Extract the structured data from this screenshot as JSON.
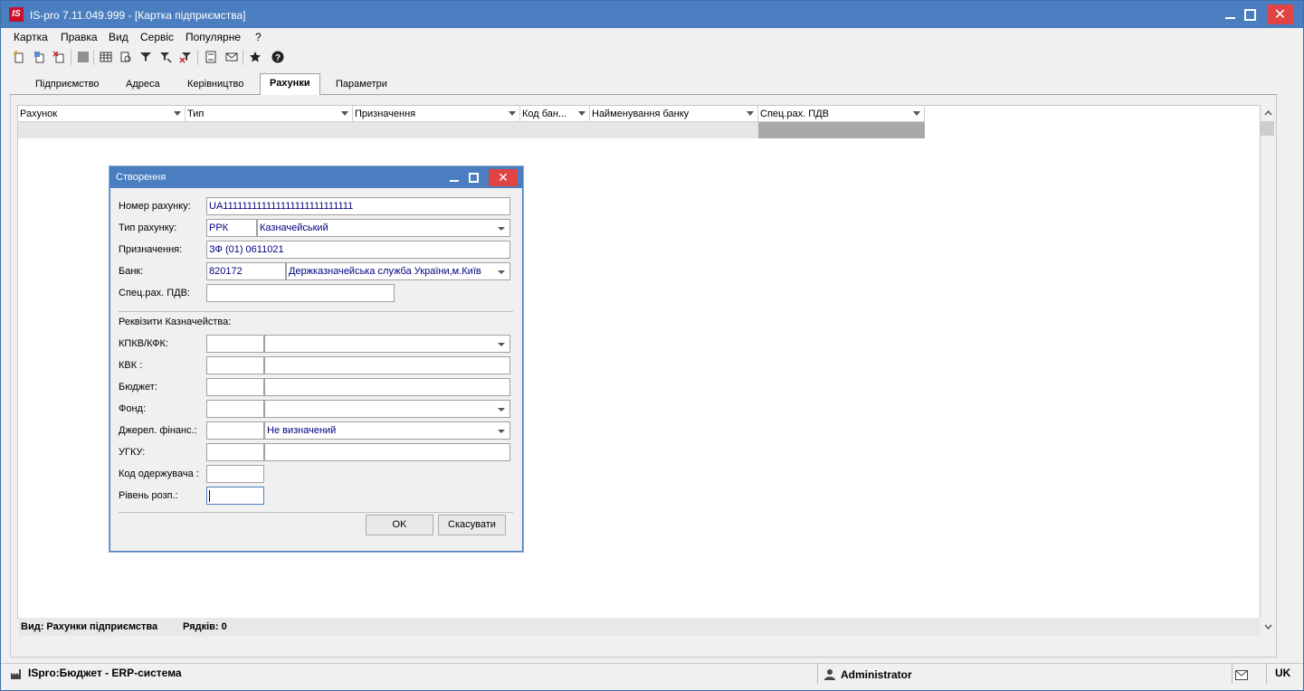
{
  "window": {
    "logo": "IS",
    "title": "IS-pro 7.11.049.999 - [Картка підприємства]",
    "close_glyph": "✕"
  },
  "menu": [
    "Картка",
    "Правка",
    "Вид",
    "Сервіс",
    "Популярне",
    "?"
  ],
  "toolbar_icons": [
    "new-doc-icon",
    "copy-doc-icon",
    "delete-doc-icon",
    "stop-icon",
    "table-icon",
    "refresh-icon",
    "filter-icon",
    "filter-edit-icon",
    "filter-clear-icon",
    "report-icon",
    "mail-icon",
    "star-icon",
    "help-icon"
  ],
  "tabs": [
    {
      "label": "Підприємство"
    },
    {
      "label": "Адреса"
    },
    {
      "label": "Керівництво"
    },
    {
      "label": "Рахунки"
    },
    {
      "label": "Параметри"
    }
  ],
  "grid": {
    "columns": [
      "Рахунок",
      "Тип",
      "Призначення",
      "Код бан...",
      "Найменування банку",
      "Спец.рах. ПДВ"
    ],
    "footer_view": "Вид: Рахунки підприємства",
    "footer_rows": "Рядків: 0"
  },
  "status": {
    "system": "ISpro:Бюджет - ERP-система",
    "user": "Administrator",
    "lang": "UK"
  },
  "dialog": {
    "title": "Створення",
    "close_glyph": "✕",
    "labels": {
      "account_number": "Номер рахунку:",
      "account_type": "Тип рахунку:",
      "purpose": "Призначення:",
      "bank": "Банк:",
      "vat_account": "Спец.рах. ПДВ:",
      "treasury_section": "Реквізити Казначейства:",
      "kpkv": "КПКВ/КФК:",
      "kvk": "КВК :",
      "budget": "Бюджет:",
      "fund": "Фонд:",
      "funding_source": "Джерел. фінанс.:",
      "ugku": "УГКУ:",
      "recipient_code": "Код одержувача :",
      "distribution_level": "Рівень розп.:"
    },
    "values": {
      "account_number": "UA111111111111111111111111111",
      "account_type_code": "РРК",
      "account_type_name": "Казначейський",
      "purpose": "ЗФ (01) 0611021",
      "bank_code": "820172",
      "bank_name": "Держказначейська служба України,м.Київ",
      "vat_account": "",
      "funding_source_name": "Не визначений"
    },
    "buttons": {
      "ok": "OK",
      "cancel": "Скасувати"
    }
  }
}
